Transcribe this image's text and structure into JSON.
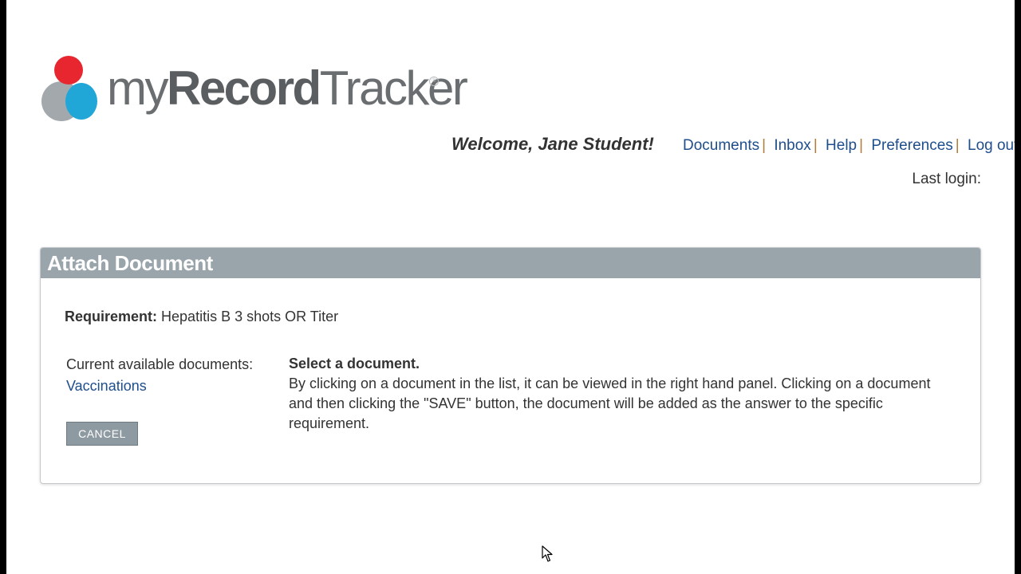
{
  "logo": {
    "text_light": "my",
    "text_bold": "Record",
    "text_end": "Tracker",
    "registered": "®",
    "colors": {
      "red": "#e8262f",
      "gray": "#a3a8ad",
      "blue": "#21a6d8"
    }
  },
  "header": {
    "welcome": "Welcome, Jane Student!",
    "nav": [
      {
        "label": "Documents"
      },
      {
        "label": "Inbox"
      },
      {
        "label": "Help"
      },
      {
        "label": "Preferences"
      },
      {
        "label": "Log out"
      }
    ],
    "nav_separator": "|",
    "last_login": "Last login:"
  },
  "panel": {
    "title": "Attach Document",
    "requirement_label": "Requirement:",
    "requirement_value": "Hepatitis B 3 shots OR Titer",
    "current_docs_label": "Current available documents:",
    "documents": [
      "Vaccinations"
    ],
    "cancel_label": "CANCEL",
    "select_title": "Select a document.",
    "select_description": "By clicking on a document in the list, it can be viewed in the right hand panel. Clicking on a document and then clicking the \"SAVE\" button, the document will be added as the answer to the specific requirement."
  },
  "colors": {
    "header_bar": "#9aa5ab",
    "link": "#1f4e8c",
    "separator": "#b07c3a",
    "button": "#8e9aa1"
  }
}
